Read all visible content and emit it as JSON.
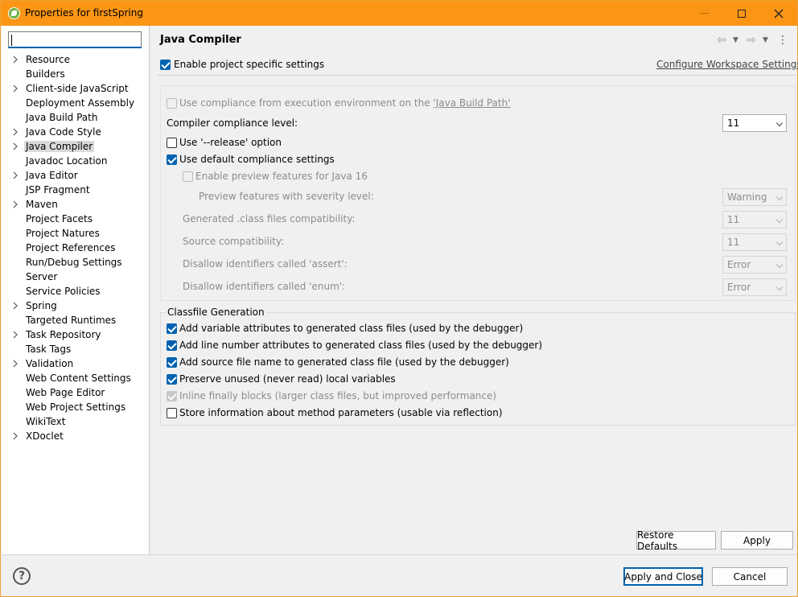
{
  "window": {
    "title": "Properties for firstSpring"
  },
  "sidebar": {
    "filter_value": "",
    "items": [
      {
        "label": "Resource",
        "expandable": true
      },
      {
        "label": "Builders",
        "expandable": false
      },
      {
        "label": "Client-side JavaScript",
        "expandable": true
      },
      {
        "label": "Deployment Assembly",
        "expandable": false
      },
      {
        "label": "Java Build Path",
        "expandable": false
      },
      {
        "label": "Java Code Style",
        "expandable": true
      },
      {
        "label": "Java Compiler",
        "expandable": true,
        "selected": true
      },
      {
        "label": "Javadoc Location",
        "expandable": false
      },
      {
        "label": "Java Editor",
        "expandable": true
      },
      {
        "label": "JSP Fragment",
        "expandable": false
      },
      {
        "label": "Maven",
        "expandable": true
      },
      {
        "label": "Project Facets",
        "expandable": false
      },
      {
        "label": "Project Natures",
        "expandable": false
      },
      {
        "label": "Project References",
        "expandable": false
      },
      {
        "label": "Run/Debug Settings",
        "expandable": false
      },
      {
        "label": "Server",
        "expandable": false
      },
      {
        "label": "Service Policies",
        "expandable": false
      },
      {
        "label": "Spring",
        "expandable": true
      },
      {
        "label": "Targeted Runtimes",
        "expandable": false
      },
      {
        "label": "Task Repository",
        "expandable": true
      },
      {
        "label": "Task Tags",
        "expandable": false
      },
      {
        "label": "Validation",
        "expandable": true
      },
      {
        "label": "Web Content Settings",
        "expandable": false
      },
      {
        "label": "Web Page Editor",
        "expandable": false
      },
      {
        "label": "Web Project Settings",
        "expandable": false
      },
      {
        "label": "WikiText",
        "expandable": false
      },
      {
        "label": "XDoclet",
        "expandable": true
      }
    ]
  },
  "page": {
    "title": "Java Compiler",
    "enable_project_specific": "Enable project specific settings",
    "configure_workspace": "Configure Workspace Settings...",
    "use_compliance_prefix": "Use compliance from execution environment on the ",
    "use_compliance_link": "'Java Build Path'",
    "compliance_level_label": "Compiler compliance level:",
    "compliance_level_value": "11",
    "use_release": "Use '--release' option",
    "use_default_compliance": "Use default compliance settings",
    "enable_preview": "Enable preview features for Java 16",
    "preview_severity_label": "Preview features with severity level:",
    "preview_severity_value": "Warning",
    "generated_compat_label": "Generated .class files compatibility:",
    "generated_compat_value": "11",
    "source_compat_label": "Source compatibility:",
    "source_compat_value": "11",
    "disallow_assert_label": "Disallow identifiers called 'assert':",
    "disallow_assert_value": "Error",
    "disallow_enum_label": "Disallow identifiers called 'enum':",
    "disallow_enum_value": "Error",
    "classfile_group": "Classfile Generation",
    "classfile_options": [
      "Add variable attributes to generated class files (used by the debugger)",
      "Add line number attributes to generated class files (used by the debugger)",
      "Add source file name to generated class file (used by the debugger)",
      "Preserve unused (never read) local variables",
      "Inline finally blocks (larger class files, but improved performance)",
      "Store information about method parameters (usable via reflection)"
    ],
    "restore_defaults": "Restore Defaults",
    "apply": "Apply"
  },
  "footer": {
    "help": "?",
    "apply_and_close": "Apply and Close",
    "cancel": "Cancel"
  },
  "colors": {
    "titlebar": "#fa9516",
    "accent": "#0063b1"
  }
}
